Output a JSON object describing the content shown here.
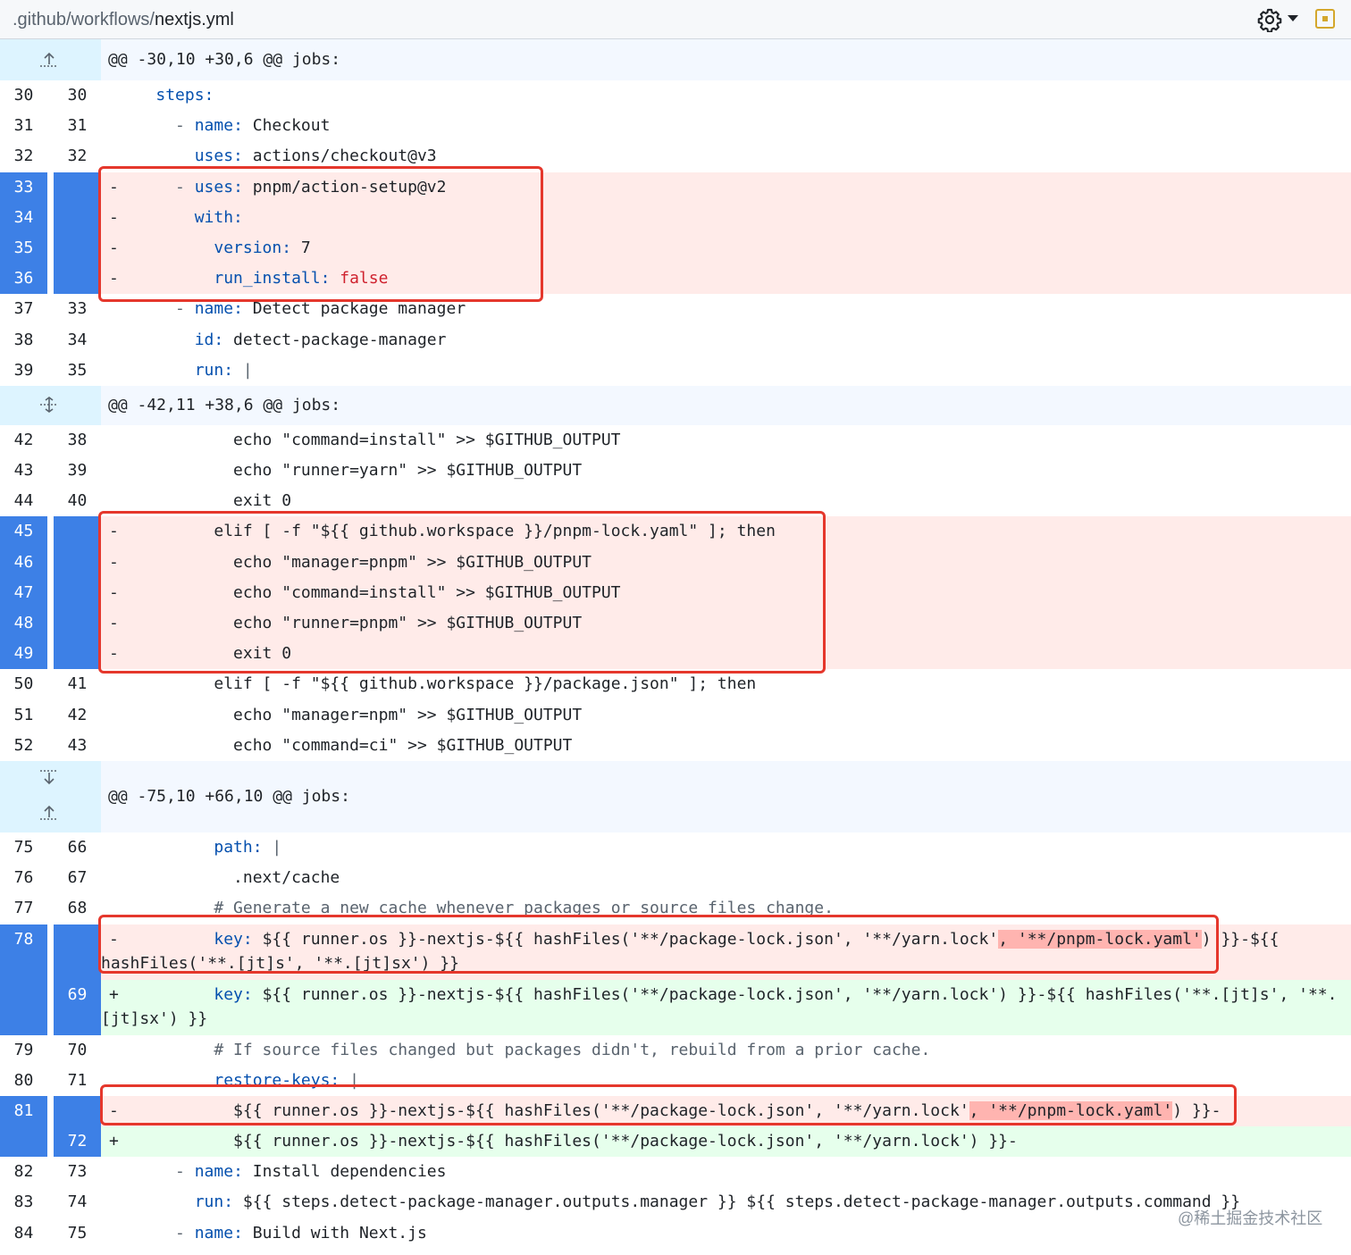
{
  "header": {
    "path_prefix": ".github/workflows/",
    "file_name": "nextjs.yml",
    "icons": [
      "gear-icon",
      "chevron-down-icon",
      "view-file-icon"
    ]
  },
  "hunks": [
    {
      "text": "@@ -30,10 +30,6 @@ jobs:",
      "expand": "expand-up-icon"
    },
    {
      "text": "@@ -42,11 +38,6 @@ jobs:",
      "expand": "expand-both-icon"
    },
    {
      "text": "@@ -75,10 +66,10 @@ jobs:",
      "expand": "expand-up-down-icon"
    }
  ],
  "lines": [
    {
      "o": "30",
      "n": "30",
      "type": "ctx",
      "marker": "",
      "indent": "    ",
      "tokens": [
        {
          "t": "steps:",
          "c": "k"
        }
      ]
    },
    {
      "o": "31",
      "n": "31",
      "type": "ctx",
      "marker": "",
      "indent": "      ",
      "tokens": [
        {
          "t": "- ",
          "c": "c"
        },
        {
          "t": "name:",
          "c": "k"
        },
        {
          "t": " Checkout",
          "c": ""
        }
      ]
    },
    {
      "o": "32",
      "n": "32",
      "type": "ctx",
      "marker": "",
      "indent": "        ",
      "tokens": [
        {
          "t": "uses:",
          "c": "k"
        },
        {
          "t": " actions/checkout@v3",
          "c": ""
        }
      ]
    },
    {
      "o": "33",
      "n": "",
      "type": "del",
      "marker": "-",
      "indent": "      ",
      "tokens": [
        {
          "t": "- ",
          "c": "c"
        },
        {
          "t": "uses:",
          "c": "k"
        },
        {
          "t": " pnpm/action-setup@v2",
          "c": ""
        }
      ]
    },
    {
      "o": "34",
      "n": "",
      "type": "del",
      "marker": "-",
      "indent": "        ",
      "tokens": [
        {
          "t": "with:",
          "c": "k"
        }
      ]
    },
    {
      "o": "35",
      "n": "",
      "type": "del",
      "marker": "-",
      "indent": "          ",
      "tokens": [
        {
          "t": "version:",
          "c": "k"
        },
        {
          "t": " 7",
          "c": ""
        }
      ]
    },
    {
      "o": "36",
      "n": "",
      "type": "del",
      "marker": "-",
      "indent": "          ",
      "tokens": [
        {
          "t": "run_install:",
          "c": "k"
        },
        {
          "t": " false",
          "c": "f"
        }
      ]
    },
    {
      "o": "37",
      "n": "33",
      "type": "ctx",
      "marker": "",
      "indent": "      ",
      "tokens": [
        {
          "t": "- ",
          "c": "c"
        },
        {
          "t": "name:",
          "c": "k"
        },
        {
          "t": " Detect package manager",
          "c": ""
        }
      ]
    },
    {
      "o": "38",
      "n": "34",
      "type": "ctx",
      "marker": "",
      "indent": "        ",
      "tokens": [
        {
          "t": "id:",
          "c": "k"
        },
        {
          "t": " detect-package-manager",
          "c": ""
        }
      ]
    },
    {
      "o": "39",
      "n": "35",
      "type": "ctx",
      "marker": "",
      "indent": "        ",
      "tokens": [
        {
          "t": "run:",
          "c": "k"
        },
        {
          "t": " |",
          "c": "c"
        }
      ]
    },
    {
      "hunk": 1
    },
    {
      "o": "42",
      "n": "38",
      "type": "ctx",
      "marker": "",
      "indent": "            ",
      "tokens": [
        {
          "t": "echo \"command=install\" >> $GITHUB_OUTPUT",
          "c": ""
        }
      ]
    },
    {
      "o": "43",
      "n": "39",
      "type": "ctx",
      "marker": "",
      "indent": "            ",
      "tokens": [
        {
          "t": "echo \"runner=yarn\" >> $GITHUB_OUTPUT",
          "c": ""
        }
      ]
    },
    {
      "o": "44",
      "n": "40",
      "type": "ctx",
      "marker": "",
      "indent": "            ",
      "tokens": [
        {
          "t": "exit 0",
          "c": ""
        }
      ]
    },
    {
      "o": "45",
      "n": "",
      "type": "del",
      "marker": "-",
      "indent": "          ",
      "tokens": [
        {
          "t": "elif [ -f \"${{ github.workspace }}/pnpm-lock.yaml\" ]; then",
          "c": ""
        }
      ]
    },
    {
      "o": "46",
      "n": "",
      "type": "del",
      "marker": "-",
      "indent": "            ",
      "tokens": [
        {
          "t": "echo \"manager=pnpm\" >> $GITHUB_OUTPUT",
          "c": ""
        }
      ]
    },
    {
      "o": "47",
      "n": "",
      "type": "del",
      "marker": "-",
      "indent": "            ",
      "tokens": [
        {
          "t": "echo \"command=install\" >> $GITHUB_OUTPUT",
          "c": ""
        }
      ]
    },
    {
      "o": "48",
      "n": "",
      "type": "del",
      "marker": "-",
      "indent": "            ",
      "tokens": [
        {
          "t": "echo \"runner=pnpm\" >> $GITHUB_OUTPUT",
          "c": ""
        }
      ]
    },
    {
      "o": "49",
      "n": "",
      "type": "del",
      "marker": "-",
      "indent": "            ",
      "tokens": [
        {
          "t": "exit 0",
          "c": ""
        }
      ]
    },
    {
      "o": "50",
      "n": "41",
      "type": "ctx",
      "marker": "",
      "indent": "          ",
      "tokens": [
        {
          "t": "elif [ -f \"${{ github.workspace }}/package.json\" ]; then",
          "c": ""
        }
      ]
    },
    {
      "o": "51",
      "n": "42",
      "type": "ctx",
      "marker": "",
      "indent": "            ",
      "tokens": [
        {
          "t": "echo \"manager=npm\" >> $GITHUB_OUTPUT",
          "c": ""
        }
      ]
    },
    {
      "o": "52",
      "n": "43",
      "type": "ctx",
      "marker": "",
      "indent": "            ",
      "tokens": [
        {
          "t": "echo \"command=ci\" >> $GITHUB_OUTPUT",
          "c": ""
        }
      ]
    },
    {
      "hunk": 2
    },
    {
      "o": "75",
      "n": "66",
      "type": "ctx",
      "marker": "",
      "indent": "          ",
      "tokens": [
        {
          "t": "path:",
          "c": "k"
        },
        {
          "t": " |",
          "c": "c"
        }
      ]
    },
    {
      "o": "76",
      "n": "67",
      "type": "ctx",
      "marker": "",
      "indent": "            ",
      "tokens": [
        {
          "t": ".next/cache",
          "c": ""
        }
      ]
    },
    {
      "o": "77",
      "n": "68",
      "type": "ctx",
      "marker": "",
      "indent": "          ",
      "tokens": [
        {
          "t": "# Generate a new cache whenever packages or source files change.",
          "c": "c"
        }
      ]
    },
    {
      "o": "78",
      "n": "",
      "type": "del",
      "marker": "-",
      "wrap": true,
      "indent": "          ",
      "tokens": [
        {
          "t": "key:",
          "c": "k"
        },
        {
          "t": " ${{ runner.os }}-nextjs-${{ hashFiles('**/package-lock.json', '**/yarn.lock'",
          "c": ""
        },
        {
          "t": ", '**/pnpm-lock.yaml'",
          "c": "hl"
        },
        {
          "t": ") }}-${{ hashFiles('**.[jt]s', '**.[jt]sx') }}",
          "c": ""
        }
      ]
    },
    {
      "o": "",
      "n": "69",
      "type": "add",
      "marker": "+",
      "wrap": true,
      "indent": "          ",
      "tokens": [
        {
          "t": "key:",
          "c": "k"
        },
        {
          "t": " ${{ runner.os }}-nextjs-${{ hashFiles('**/package-lock.json', '**/yarn.lock') }}-${{ hashFiles('**.[jt]s', '**.[jt]sx') }}",
          "c": ""
        }
      ]
    },
    {
      "o": "79",
      "n": "70",
      "type": "ctx",
      "marker": "",
      "indent": "          ",
      "tokens": [
        {
          "t": "# If source files changed but packages didn't, rebuild from a prior cache.",
          "c": "c"
        }
      ]
    },
    {
      "o": "80",
      "n": "71",
      "type": "ctx",
      "marker": "",
      "indent": "          ",
      "tokens": [
        {
          "t": "restore-keys:",
          "c": "k"
        },
        {
          "t": " |",
          "c": "c"
        }
      ]
    },
    {
      "o": "81",
      "n": "",
      "type": "del",
      "marker": "-",
      "indent": "            ",
      "tokens": [
        {
          "t": "${{ runner.os }}-nextjs-${{ hashFiles('**/package-lock.json', '**/yarn.lock'",
          "c": ""
        },
        {
          "t": ", '**/pnpm-lock.yaml'",
          "c": "hl"
        },
        {
          "t": ") }}-",
          "c": ""
        }
      ]
    },
    {
      "o": "",
      "n": "72",
      "type": "add",
      "marker": "+",
      "indent": "            ",
      "tokens": [
        {
          "t": "${{ runner.os }}-nextjs-${{ hashFiles('**/package-lock.json', '**/yarn.lock') }}-",
          "c": ""
        }
      ]
    },
    {
      "o": "82",
      "n": "73",
      "type": "ctx",
      "marker": "",
      "indent": "      ",
      "tokens": [
        {
          "t": "- ",
          "c": "c"
        },
        {
          "t": "name:",
          "c": "k"
        },
        {
          "t": " Install dependencies",
          "c": ""
        }
      ]
    },
    {
      "o": "83",
      "n": "74",
      "type": "ctx",
      "marker": "",
      "indent": "        ",
      "tokens": [
        {
          "t": "run:",
          "c": "k"
        },
        {
          "t": " ${{ steps.detect-package-manager.outputs.manager }} ${{ steps.detect-package-manager.outputs.command }}",
          "c": ""
        }
      ]
    },
    {
      "o": "84",
      "n": "75",
      "type": "ctx",
      "marker": "",
      "indent": "      ",
      "tokens": [
        {
          "t": "- ",
          "c": "c"
        },
        {
          "t": "name:",
          "c": "k"
        },
        {
          "t": " Build with Next.js",
          "c": ""
        }
      ]
    }
  ],
  "watermark": "@稀土掘金技术社区",
  "colors": {
    "highlight_box": "#e5372c",
    "selected_line": "#3d80e6",
    "deletion": "#ffebe9",
    "addition": "#e6ffec",
    "keyword": "#0550ae"
  }
}
